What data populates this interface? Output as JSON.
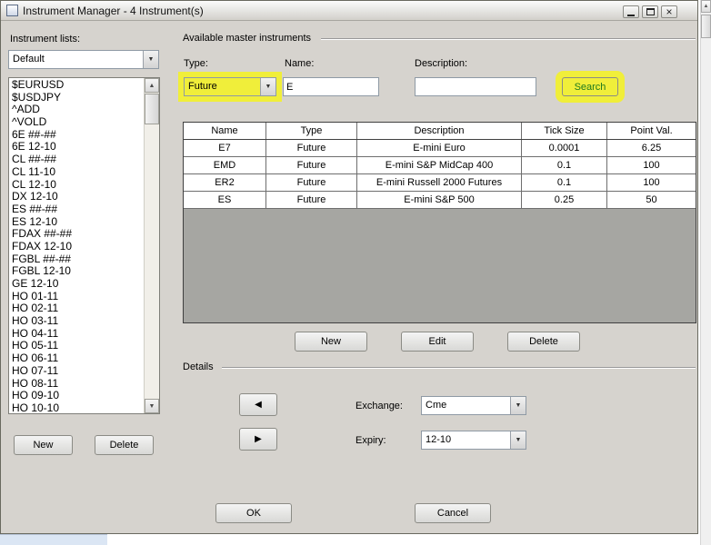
{
  "window": {
    "title": "Instrument Manager - 4 Instrument(s)"
  },
  "icons": {
    "dropdown_arrow": "▼",
    "up_arrow": "▲",
    "down_arrow": "▼",
    "left_arrow": "◀",
    "right_arrow": "▶",
    "close": "×"
  },
  "left_panel": {
    "lists_label": "Instrument lists:",
    "selected_list": "Default",
    "instruments": [
      "$EURUSD",
      "$USDJPY",
      "^ADD",
      "^VOLD",
      "6E ##-##",
      "6E 12-10",
      "CL ##-##",
      "CL 11-10",
      "CL 12-10",
      "DX 12-10",
      "ES ##-##",
      "ES 12-10",
      "FDAX ##-##",
      "FDAX 12-10",
      "FGBL ##-##",
      "FGBL 12-10",
      "GE 12-10",
      "HO 01-11",
      "HO 02-11",
      "HO 03-11",
      "HO 04-11",
      "HO 05-11",
      "HO 06-11",
      "HO 07-11",
      "HO 08-11",
      "HO 09-10",
      "HO 10-10"
    ],
    "new_button": "New",
    "delete_button": "Delete"
  },
  "master_panel": {
    "section_title": "Available master instruments",
    "type_label": "Type:",
    "type_value": "Future",
    "name_label": "Name:",
    "name_value": "E",
    "description_label": "Description:",
    "description_value": "",
    "search_button": "Search",
    "table": {
      "columns": [
        "Name",
        "Type",
        "Description",
        "Tick Size",
        "Point Val."
      ],
      "rows": [
        [
          "E7",
          "Future",
          "E-mini Euro",
          "0.0001",
          "6.25"
        ],
        [
          "EMD",
          "Future",
          "E-mini S&P MidCap 400",
          "0.1",
          "100"
        ],
        [
          "ER2",
          "Future",
          "E-mini Russell 2000 Futures",
          "0.1",
          "100"
        ],
        [
          "ES",
          "Future",
          "E-mini S&P 500",
          "0.25",
          "50"
        ]
      ]
    },
    "new_button": "New",
    "edit_button": "Edit",
    "delete_button": "Delete"
  },
  "details_panel": {
    "section_title": "Details",
    "exchange_label": "Exchange:",
    "exchange_value": "Cme",
    "expiry_label": "Expiry:",
    "expiry_value": "12-10"
  },
  "footer": {
    "ok_button": "OK",
    "cancel_button": "Cancel"
  },
  "colors": {
    "highlight": "#f0ee3a",
    "search_text": "#1f7a1f",
    "dialog_bg": "#d6d3ce",
    "table_empty": "#a6a6a2"
  }
}
